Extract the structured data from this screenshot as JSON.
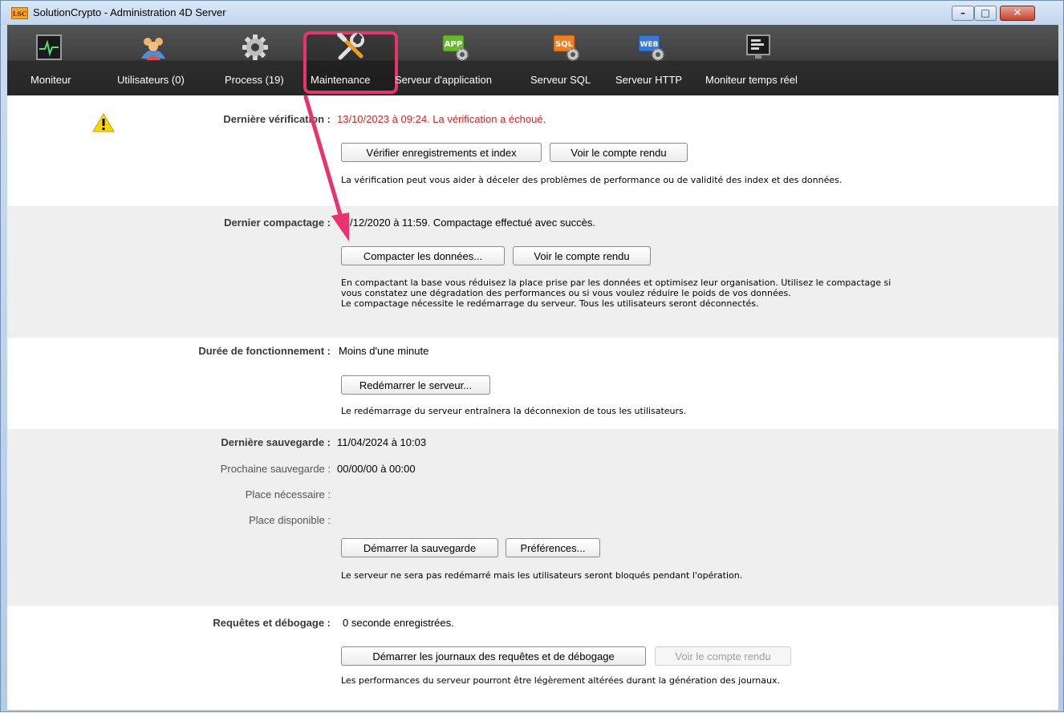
{
  "window": {
    "title": "SolutionCrypto - Administration 4D Server",
    "app_icon": "LSC",
    "controls": {
      "minimize": "minimize-icon",
      "maximize": "maximize-icon",
      "close": "close-icon"
    }
  },
  "toolbar": {
    "items": [
      {
        "label": "Moniteur",
        "icon": "monitor-icon"
      },
      {
        "label": "Utilisateurs (0)",
        "icon": "users-icon"
      },
      {
        "label": "Process (19)",
        "icon": "gear-icon"
      },
      {
        "label": "Maintenance",
        "icon": "tools-icon",
        "selected": true
      },
      {
        "label": "Serveur d'application",
        "icon": "app-server-icon",
        "badge": "APP"
      },
      {
        "label": "Serveur SQL",
        "icon": "sql-server-icon",
        "badge": "SQL"
      },
      {
        "label": "Serveur HTTP",
        "icon": "http-server-icon",
        "badge": "WEB"
      },
      {
        "label": "Moniteur temps réel",
        "icon": "realtime-monitor-icon"
      }
    ],
    "highlight_color": "#e8336e"
  },
  "verification": {
    "label": "Dernière vérification :",
    "value": "13/10/2023 à 09:24. La vérification a échoué.",
    "btn_verify": "Vérifier enregistrements et index",
    "btn_report": "Voir le compte rendu",
    "description": "La vérification peut vous aider à déceler des problèmes de performance ou de validité des index et des données."
  },
  "compaction": {
    "label": "Dernier compactage :",
    "value": "/12/2020 à 11:59.  Compactage effectué avec succès.",
    "btn_compact": "Compacter les données...",
    "btn_report": "Voir le compte rendu",
    "description": "En compactant la base vous réduisez la place prise par les données et optimisez leur organisation. Utilisez le compactage si\nvous constatez une dégradation des performances ou si vous voulez réduire le poids de vos données.\nLe compactage nécessite le redémarrage du serveur. Tous les utilisateurs seront déconnectés."
  },
  "uptime": {
    "label": "Durée de fonctionnement :",
    "value": "Moins d'une minute",
    "btn_restart": "Redémarrer le serveur...",
    "description": "Le redémarrage du serveur entraînera la déconnexion de tous les utilisateurs."
  },
  "backup": {
    "last_label": "Dernière sauvegarde :",
    "last_value": "11/04/2024 à 10:03",
    "next_label": "Prochaine sauvegarde :",
    "next_value": "00/00/00 à 00:00",
    "needed_label": "Place nécessaire :",
    "available_label": "Place disponible :",
    "btn_start": "Démarrer la sauvegarde",
    "btn_prefs": "Préférences...",
    "description": "Le serveur ne sera pas redémarré mais les utilisateurs seront bloqués pendant l'opération."
  },
  "requests": {
    "label": "Requêtes et débogage :",
    "value": "0 seconde enregistrées.",
    "btn_start": "Démarrer les journaux des requêtes et de débogage",
    "btn_report": "Voir le compte rendu",
    "description": "Les performances du serveur pourront être légèrement altérées durant la génération des journaux."
  },
  "colors": {
    "error": "#e02020",
    "annotation": "#e8336e"
  }
}
